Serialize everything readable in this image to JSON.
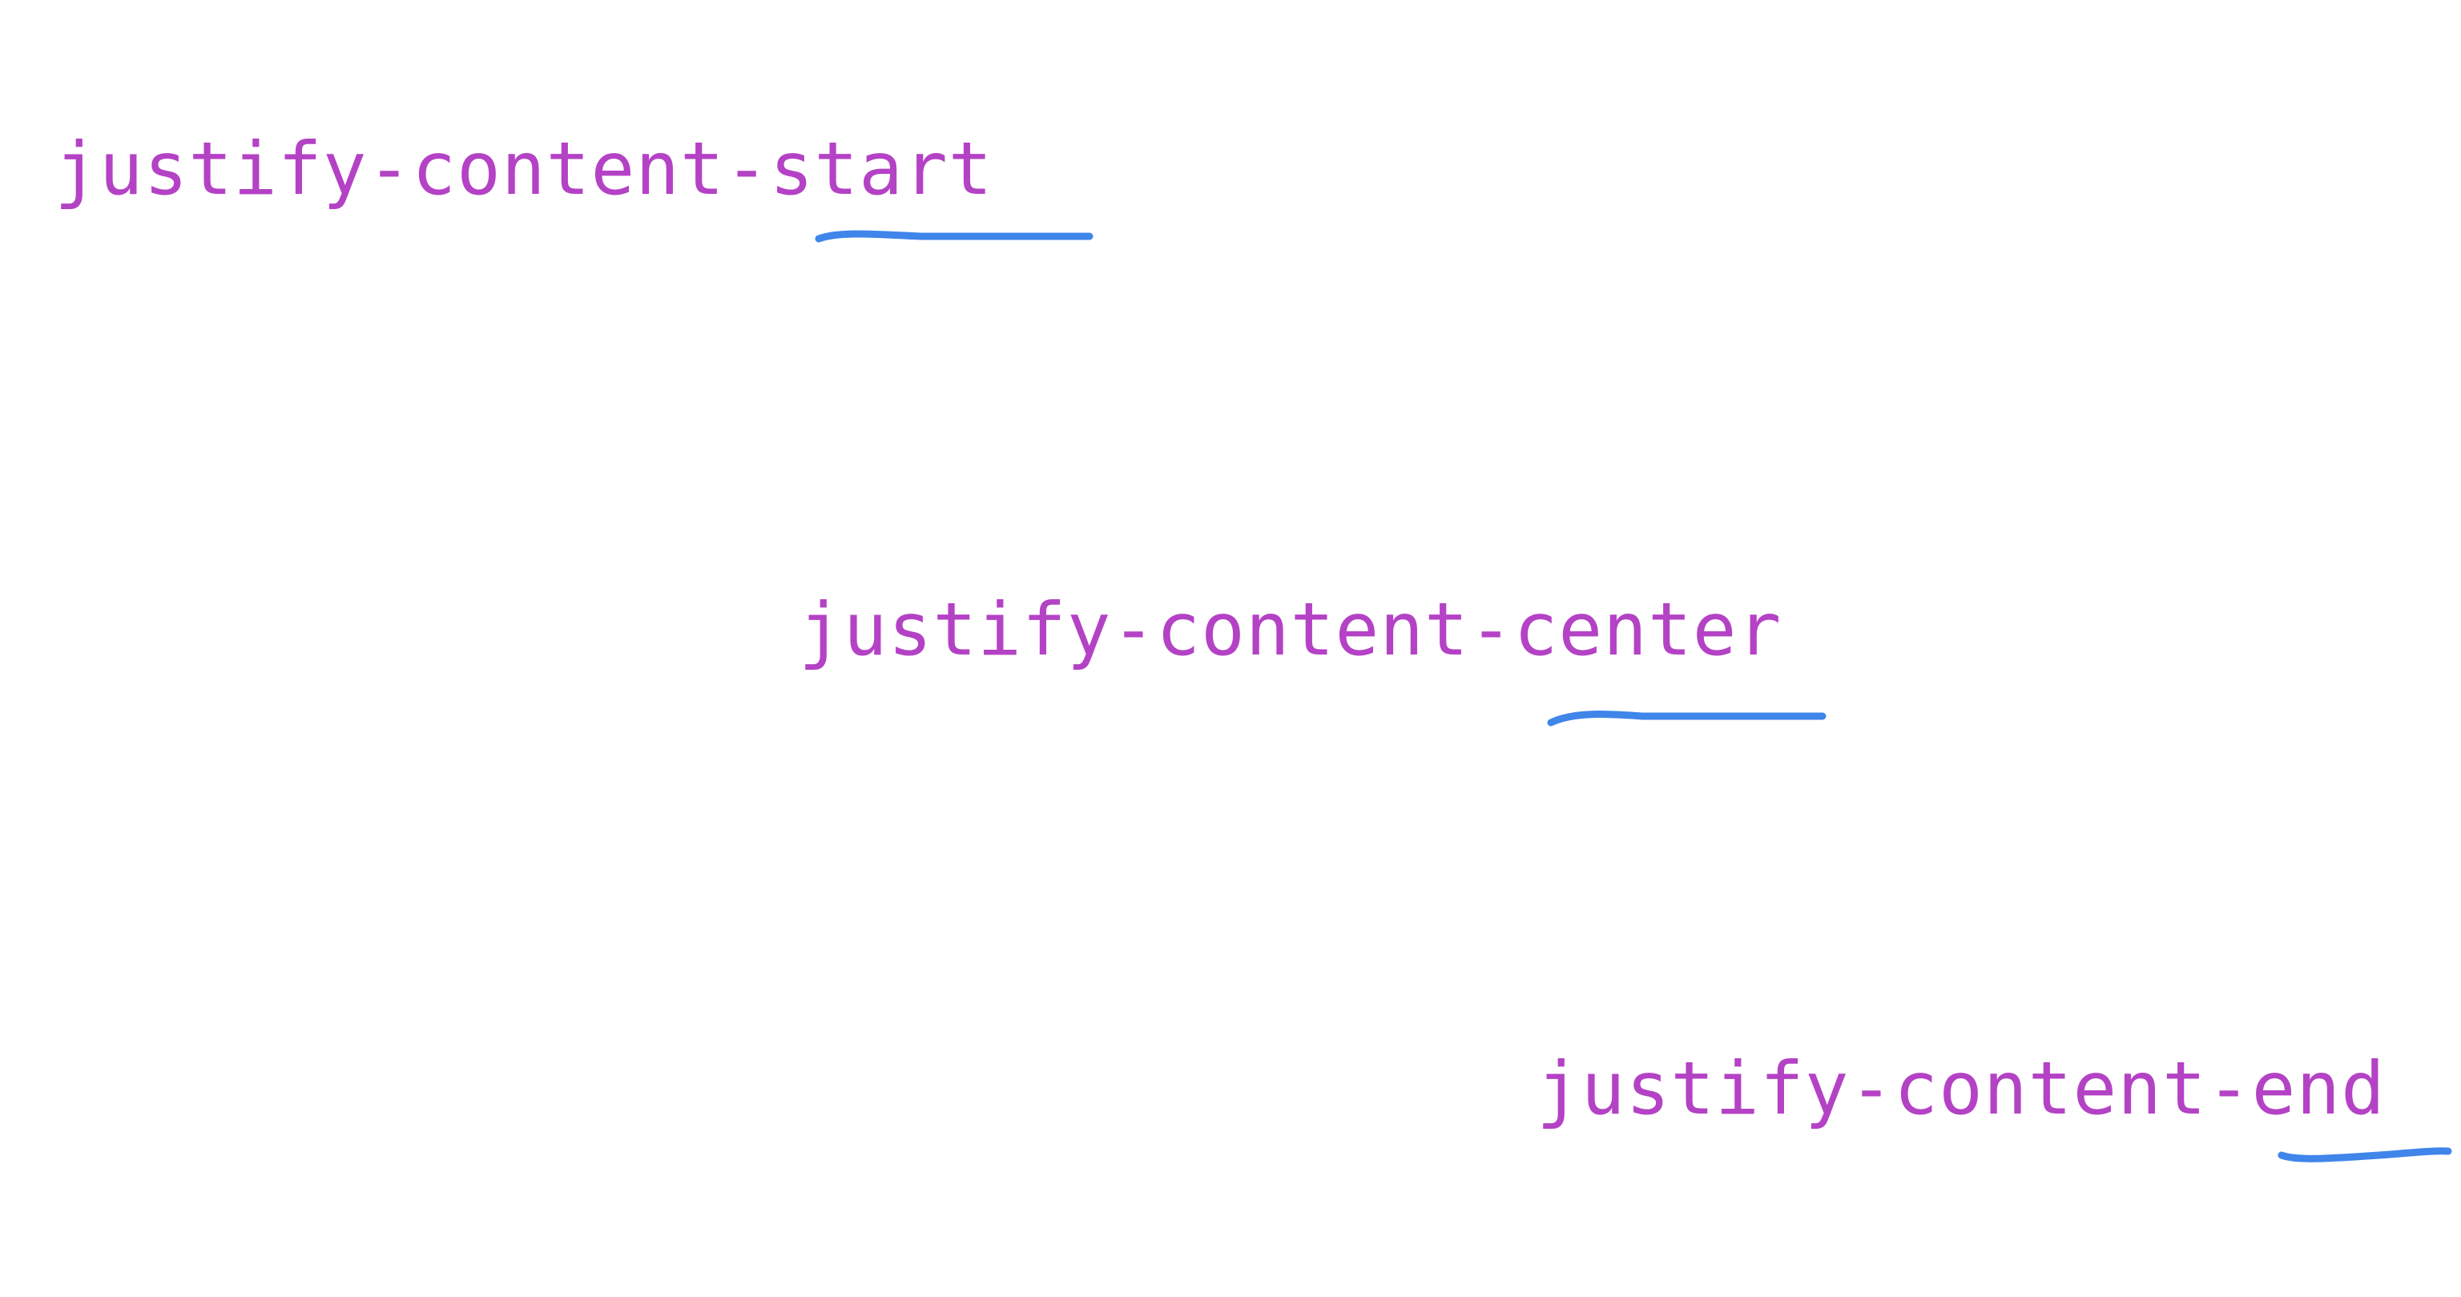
{
  "labels": {
    "start": "justify-content-start",
    "center": "justify-content-center",
    "end": "justify-content-end"
  },
  "colors": {
    "text": "#b442c5",
    "underline": "#3f85ea",
    "background": "#ffffff"
  }
}
